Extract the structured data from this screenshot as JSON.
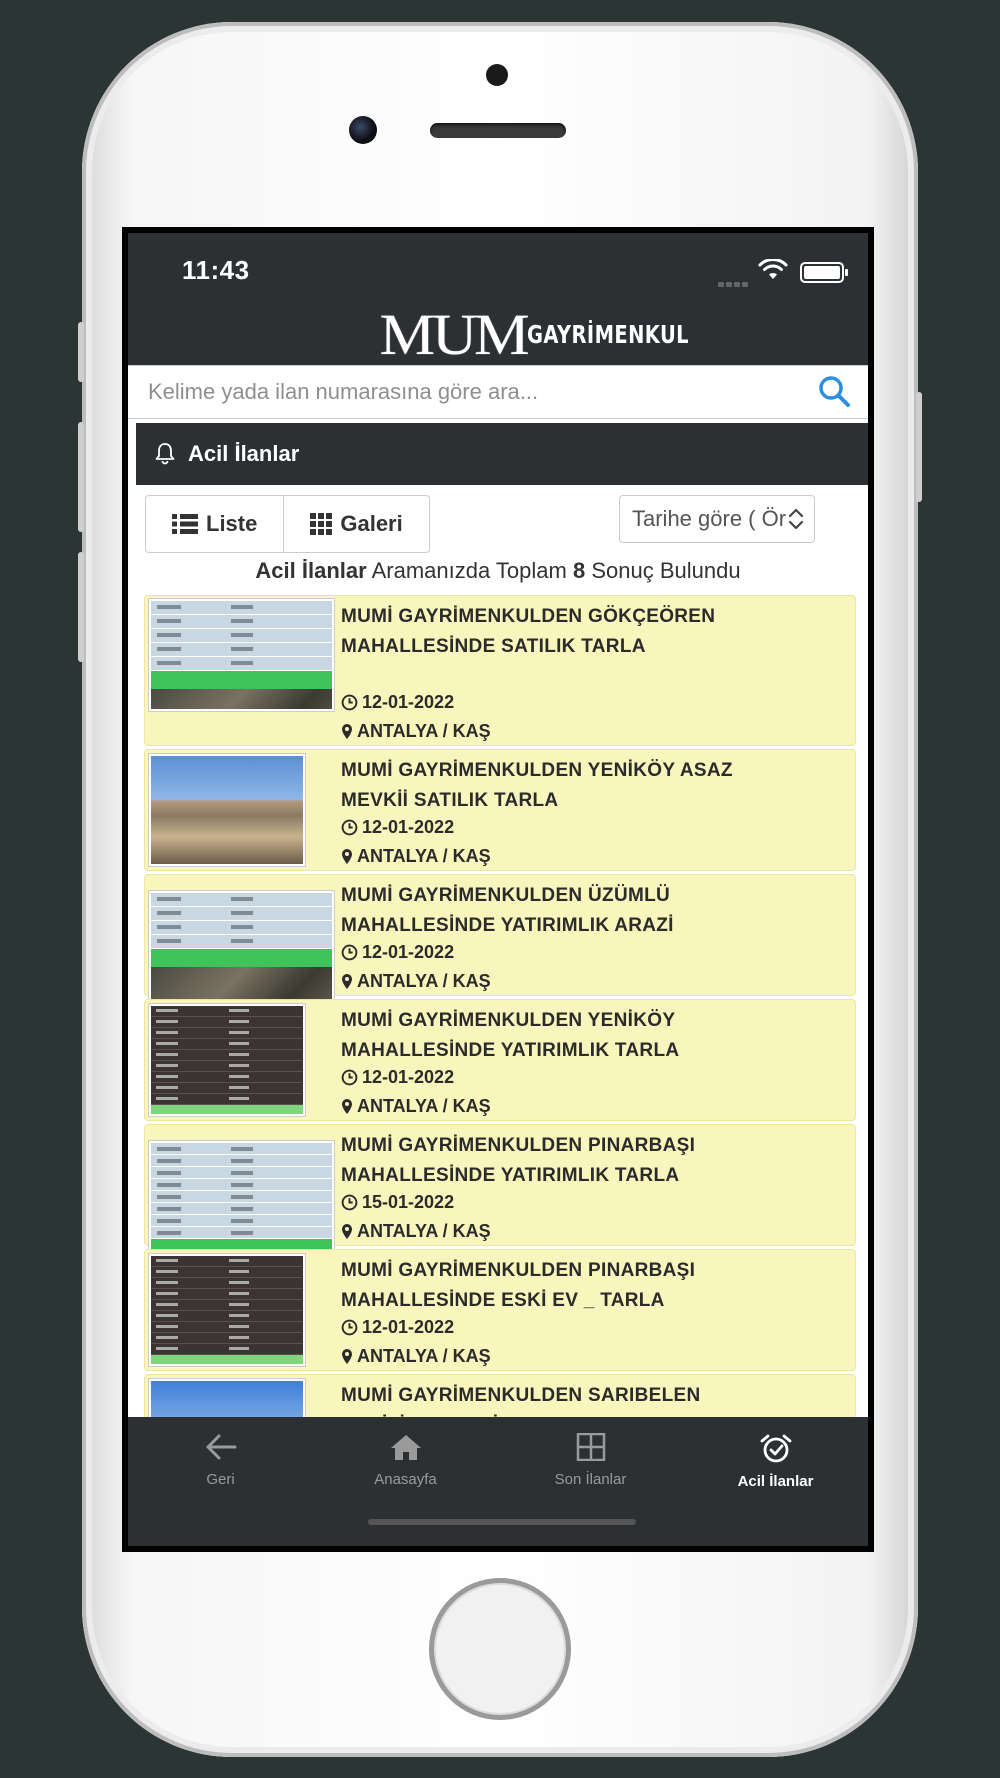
{
  "status": {
    "time": "11:43"
  },
  "brand": {
    "mark": "MUM",
    "name": "GAYRİMENKUL"
  },
  "search": {
    "placeholder": "Kelime yada ilan numarasına göre ara..."
  },
  "panel": {
    "title": "Acil İlanlar",
    "icon": "bell-icon"
  },
  "view_buttons": [
    {
      "label": "Liste",
      "icon": "list-icon"
    },
    {
      "label": "Galeri",
      "icon": "grid-icon"
    }
  ],
  "sort": {
    "value": "Tarihe göre ( Ör"
  },
  "summary": {
    "category": "Acil İlanlar",
    "middle": " Aramanızda Toplam ",
    "count": "8",
    "end": " Sonuç Bulundu"
  },
  "listings": [
    {
      "title": "MUMİ GAYRİMENKULDEN GÖKÇEÖREN MAHALLESİNDE SATILIK TARLA",
      "date": "12-01-2022",
      "location": "ANTALYA / KAŞ"
    },
    {
      "title": "MUMİ GAYRİMENKULDEN YENİKÖY ASAZ MEVKİİ SATILIK TARLA",
      "date": "12-01-2022",
      "location": "ANTALYA / KAŞ"
    },
    {
      "title": "MUMİ GAYRİMENKULDEN ÜZÜMLÜ MAHALLESİNDE YATIRIMLIK ARAZİ",
      "date": "12-01-2022",
      "location": "ANTALYA / KAŞ"
    },
    {
      "title": "MUMİ GAYRİMENKULDEN YENİKÖY MAHALLESİNDE YATIRIMLIK TARLA",
      "date": "12-01-2022",
      "location": "ANTALYA / KAŞ"
    },
    {
      "title": "MUMİ GAYRİMENKULDEN PINARBAŞI MAHALLESİNDE YATIRIMLIK TARLA",
      "date": "15-01-2022",
      "location": "ANTALYA / KAŞ"
    },
    {
      "title": "MUMİ GAYRİMENKULDEN PINARBAŞI MAHALLESİNDE ESKİ EV _ TARLA",
      "date": "12-01-2022",
      "location": "ANTALYA / KAŞ"
    },
    {
      "title": "MUMİ GAYRİMENKULDEN SARIBELEN SAHİLİNDE DENİZ MANZARALI TARLA"
    }
  ],
  "tabbar": [
    {
      "label": "Geri",
      "icon": "arrow-left-icon"
    },
    {
      "label": "Anasayfa",
      "icon": "home-icon"
    },
    {
      "label": "Son İlanlar",
      "icon": "grid-icon"
    },
    {
      "label": "Acil İlanlar",
      "icon": "alarm-clock-icon"
    }
  ],
  "colors": {
    "dark": "#2c3033",
    "listing_bg": "#f8f5bd",
    "search_icon": "#2a8fe0"
  }
}
